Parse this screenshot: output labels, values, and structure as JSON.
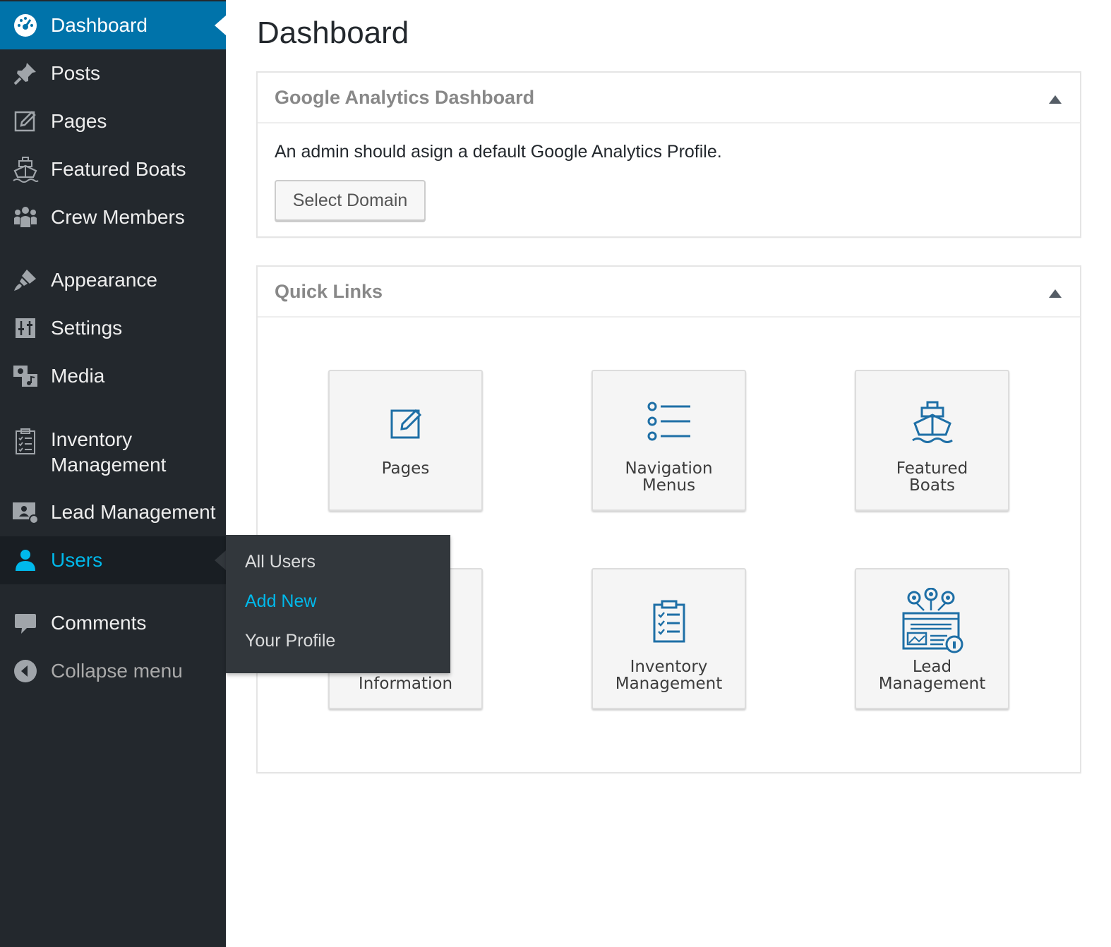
{
  "sidebar": {
    "items": [
      {
        "label": "Dashboard",
        "icon": "dashboard-icon"
      },
      {
        "label": "Posts",
        "icon": "pin-icon"
      },
      {
        "label": "Pages",
        "icon": "page-edit-icon"
      },
      {
        "label": "Featured Boats",
        "icon": "ship-icon"
      },
      {
        "label": "Crew Members",
        "icon": "people-icon"
      },
      {
        "label": "Appearance",
        "icon": "paintbrush-icon"
      },
      {
        "label": "Settings",
        "icon": "sliders-icon"
      },
      {
        "label": "Media",
        "icon": "media-icon"
      },
      {
        "label": "Inventory",
        "label2": "Management",
        "icon": "clipboard-icon"
      },
      {
        "label": "Lead Management",
        "icon": "lead-icon"
      },
      {
        "label": "Users",
        "icon": "user-icon"
      },
      {
        "label": "Comments",
        "icon": "comment-bubble-icon"
      },
      {
        "label": "Collapse menu",
        "icon": "collapse-arrow-icon"
      }
    ],
    "flyout": [
      "All Users",
      "Add New",
      "Your Profile"
    ]
  },
  "main": {
    "title": "Dashboard",
    "ga": {
      "title": "Google Analytics Dashboard",
      "message": "An admin should asign a default Google Analytics Profile.",
      "button": "Select Domain"
    },
    "quick_links": {
      "title": "Quick Links",
      "tiles": [
        {
          "line1": "Pages",
          "line2": "",
          "icon": "page-edit-icon"
        },
        {
          "line1": "Navigation",
          "line2": "Menus",
          "icon": "list-icon"
        },
        {
          "line1": "Featured",
          "line2": "Boats",
          "icon": "ship-icon"
        },
        {
          "line1": "Information",
          "line2": "",
          "icon": "info-icon"
        },
        {
          "line1": "Inventory",
          "line2": "Management",
          "icon": "clipboard-icon"
        },
        {
          "line1": "Lead",
          "line2": "Management",
          "icon": "lead-icon"
        }
      ]
    }
  },
  "colors": {
    "sidebar_bg": "#23282d",
    "accent": "#0073aa",
    "highlight": "#00b9eb",
    "tile_icon": "#1e6fa6"
  }
}
